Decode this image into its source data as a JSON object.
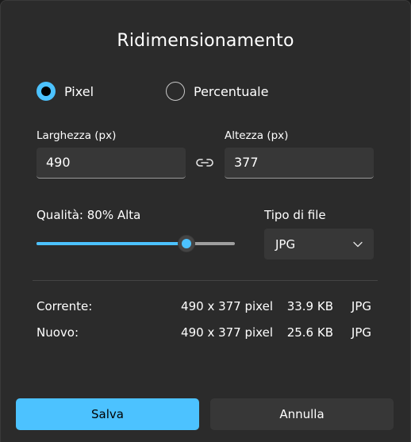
{
  "dialog": {
    "title": "Ridimensionamento"
  },
  "mode": {
    "pixel_label": "Pixel",
    "percent_label": "Percentuale",
    "selected": "Pixel"
  },
  "size": {
    "width_label": "Larghezza (px)",
    "width_value": "490",
    "height_label": "Altezza (px)",
    "height_value": "377",
    "link_icon": "link-chain-icon"
  },
  "quality": {
    "label": "Qualità: 80% Alta",
    "percent": 80
  },
  "filetype": {
    "label": "Tipo di file",
    "selected": "JPG",
    "chevron_icon": "chevron-down-icon"
  },
  "info": {
    "current": {
      "label": "Corrente:",
      "dimensions": "490 x 377 pixel",
      "size": "33.9 KB",
      "format": "JPG"
    },
    "new": {
      "label": "Nuovo:",
      "dimensions": "490 x 377 pixel",
      "size": "25.6 KB",
      "format": "JPG"
    }
  },
  "buttons": {
    "save": "Salva",
    "cancel": "Annulla"
  },
  "colors": {
    "accent": "#4cc2ff",
    "background": "#2b2b2b",
    "control": "#373737"
  }
}
